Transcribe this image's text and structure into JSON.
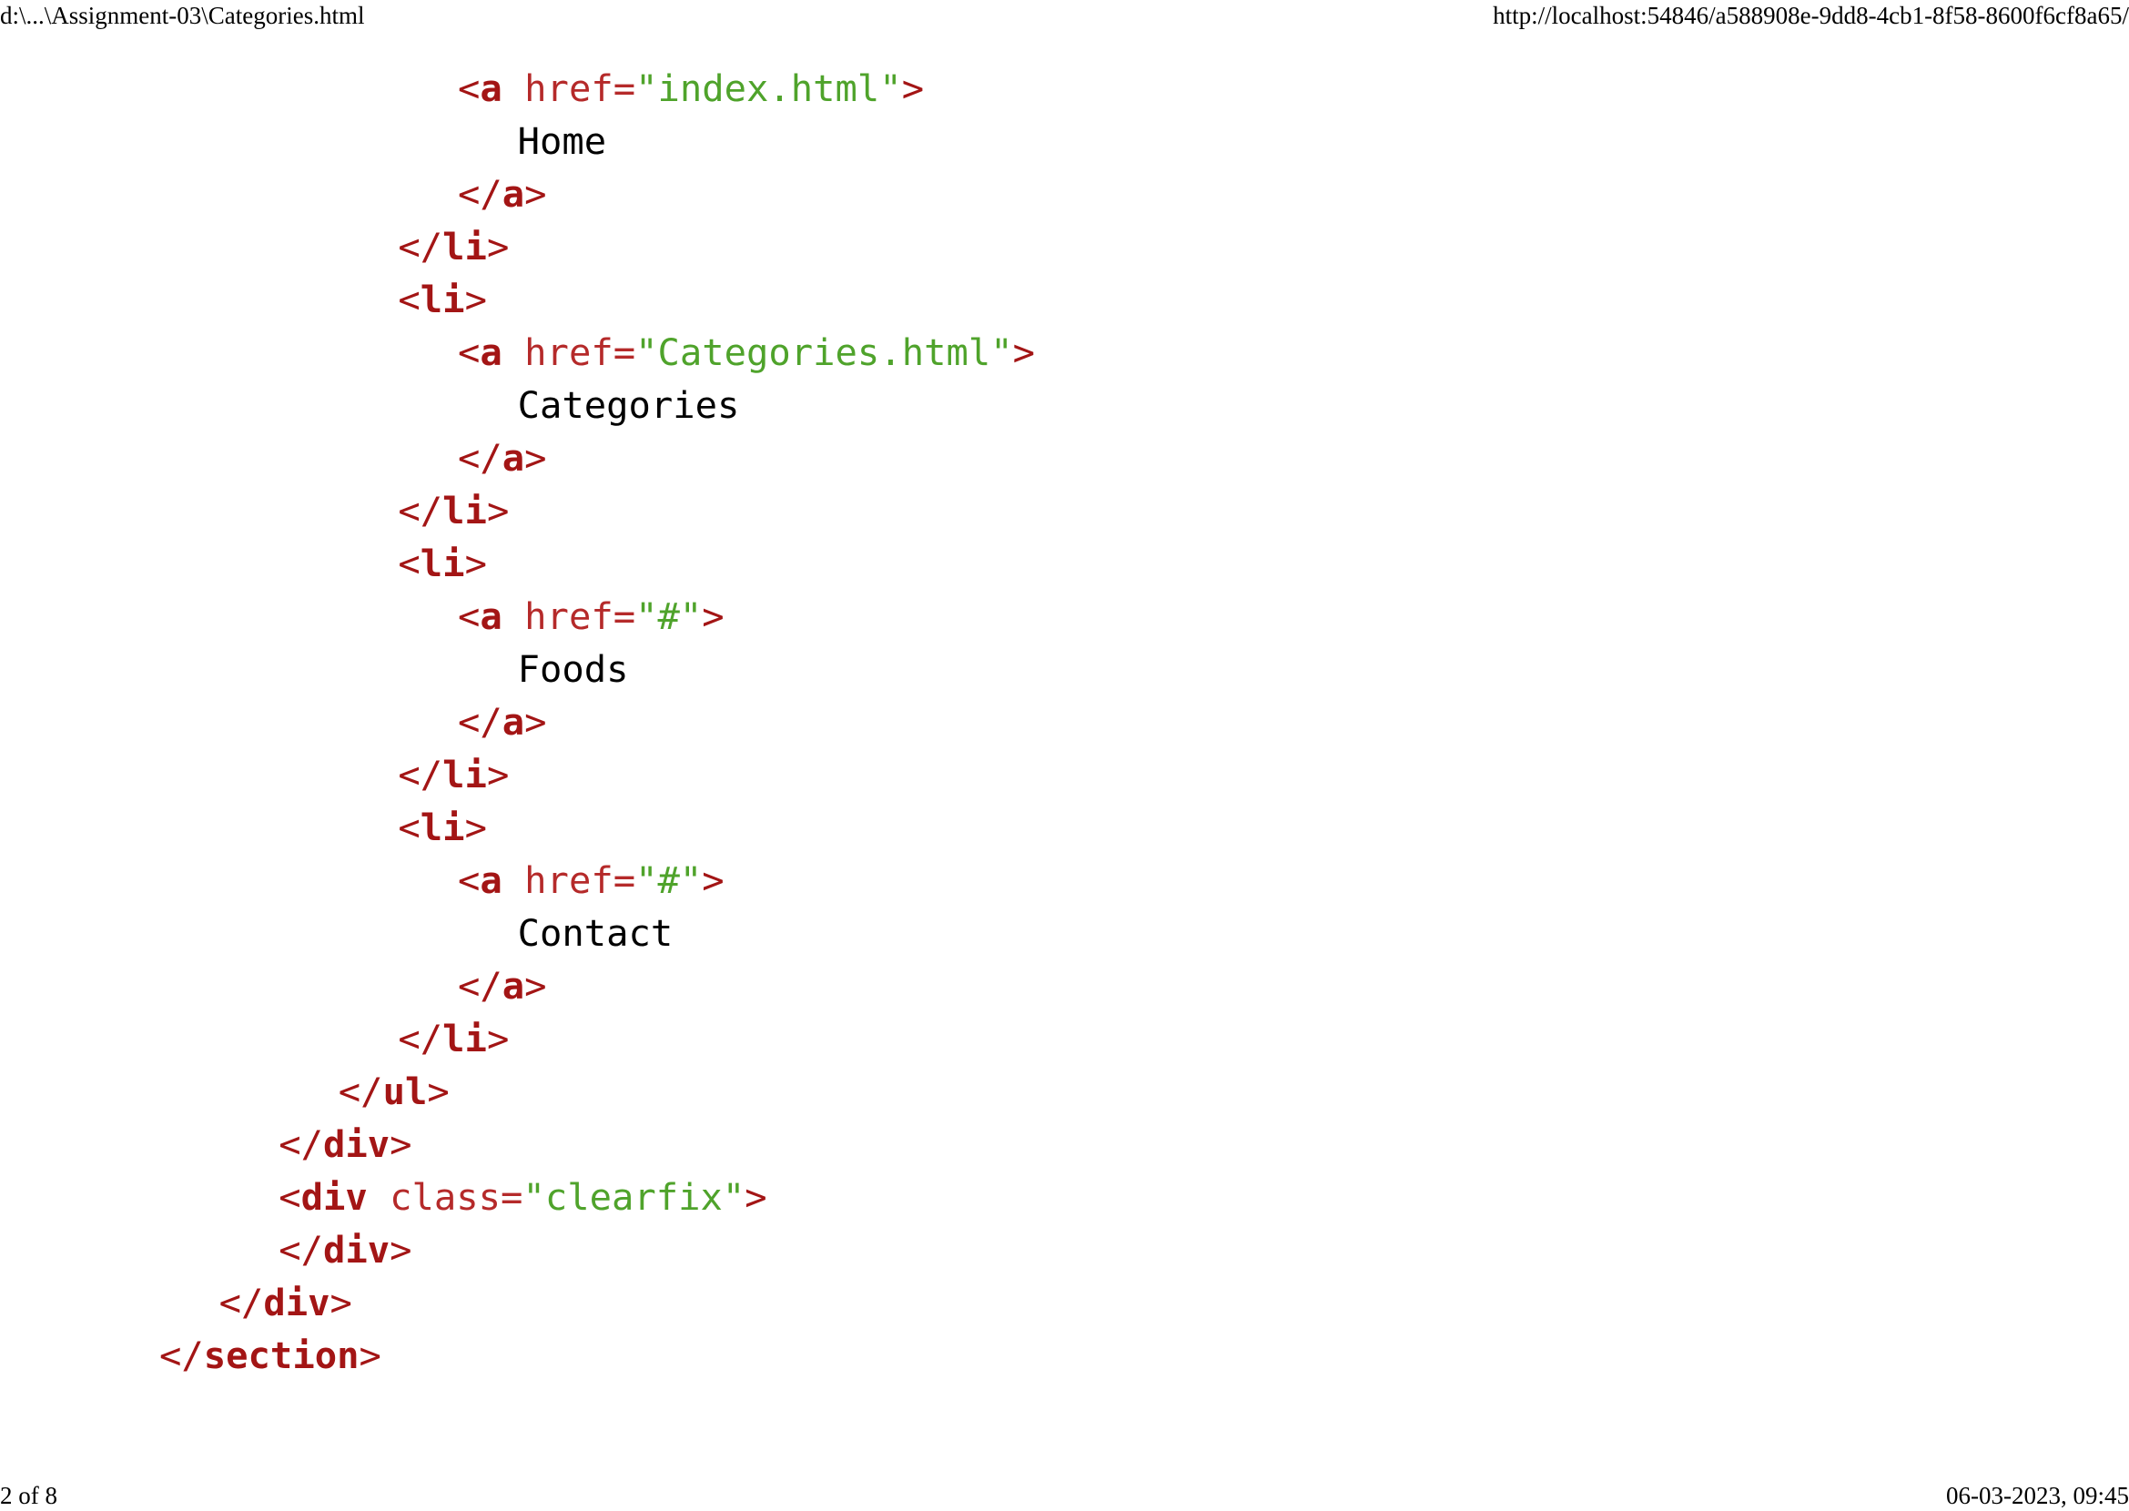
{
  "header": {
    "file_path": "d:\\...\\Assignment-03\\Categories.html",
    "url": "http://localhost:54846/a588908e-9dd8-4cb1-8f58-8600f6cf8a65/"
  },
  "footer": {
    "page_indicator": "2 of 8",
    "datetime": "06-03-2023, 09:45"
  },
  "colors": {
    "tag": "#a31515",
    "attribute_value": "#4fa32b",
    "text": "#000000"
  },
  "code": {
    "lines": [
      {
        "indent": 5,
        "tokens": [
          {
            "t": "punc",
            "v": "<"
          },
          {
            "t": "tag",
            "v": "a"
          },
          {
            "t": "punc",
            "v": " "
          },
          {
            "t": "attr",
            "v": "href="
          },
          {
            "t": "val",
            "v": "\"index.html\""
          },
          {
            "t": "punc",
            "v": ">"
          }
        ]
      },
      {
        "indent": 6,
        "tokens": [
          {
            "t": "text",
            "v": "Home"
          }
        ]
      },
      {
        "indent": 5,
        "tokens": [
          {
            "t": "punc",
            "v": "</"
          },
          {
            "t": "tag",
            "v": "a"
          },
          {
            "t": "punc",
            "v": ">"
          }
        ]
      },
      {
        "indent": 4,
        "tokens": [
          {
            "t": "punc",
            "v": "</"
          },
          {
            "t": "tag",
            "v": "li"
          },
          {
            "t": "punc",
            "v": ">"
          }
        ]
      },
      {
        "indent": 4,
        "tokens": [
          {
            "t": "punc",
            "v": "<"
          },
          {
            "t": "tag",
            "v": "li"
          },
          {
            "t": "punc",
            "v": ">"
          }
        ]
      },
      {
        "indent": 5,
        "tokens": [
          {
            "t": "punc",
            "v": "<"
          },
          {
            "t": "tag",
            "v": "a"
          },
          {
            "t": "punc",
            "v": " "
          },
          {
            "t": "attr",
            "v": "href="
          },
          {
            "t": "val",
            "v": "\"Categories.html\""
          },
          {
            "t": "punc",
            "v": ">"
          }
        ]
      },
      {
        "indent": 6,
        "tokens": [
          {
            "t": "text",
            "v": "Categories"
          }
        ]
      },
      {
        "indent": 5,
        "tokens": [
          {
            "t": "punc",
            "v": "</"
          },
          {
            "t": "tag",
            "v": "a"
          },
          {
            "t": "punc",
            "v": ">"
          }
        ]
      },
      {
        "indent": 4,
        "tokens": [
          {
            "t": "punc",
            "v": "</"
          },
          {
            "t": "tag",
            "v": "li"
          },
          {
            "t": "punc",
            "v": ">"
          }
        ]
      },
      {
        "indent": 4,
        "tokens": [
          {
            "t": "punc",
            "v": "<"
          },
          {
            "t": "tag",
            "v": "li"
          },
          {
            "t": "punc",
            "v": ">"
          }
        ]
      },
      {
        "indent": 5,
        "tokens": [
          {
            "t": "punc",
            "v": "<"
          },
          {
            "t": "tag",
            "v": "a"
          },
          {
            "t": "punc",
            "v": " "
          },
          {
            "t": "attr",
            "v": "href="
          },
          {
            "t": "val",
            "v": "\"#\""
          },
          {
            "t": "punc",
            "v": ">"
          }
        ]
      },
      {
        "indent": 6,
        "tokens": [
          {
            "t": "text",
            "v": "Foods"
          }
        ]
      },
      {
        "indent": 5,
        "tokens": [
          {
            "t": "punc",
            "v": "</"
          },
          {
            "t": "tag",
            "v": "a"
          },
          {
            "t": "punc",
            "v": ">"
          }
        ]
      },
      {
        "indent": 4,
        "tokens": [
          {
            "t": "punc",
            "v": "</"
          },
          {
            "t": "tag",
            "v": "li"
          },
          {
            "t": "punc",
            "v": ">"
          }
        ]
      },
      {
        "indent": 4,
        "tokens": [
          {
            "t": "punc",
            "v": "<"
          },
          {
            "t": "tag",
            "v": "li"
          },
          {
            "t": "punc",
            "v": ">"
          }
        ]
      },
      {
        "indent": 5,
        "tokens": [
          {
            "t": "punc",
            "v": "<"
          },
          {
            "t": "tag",
            "v": "a"
          },
          {
            "t": "punc",
            "v": " "
          },
          {
            "t": "attr",
            "v": "href="
          },
          {
            "t": "val",
            "v": "\"#\""
          },
          {
            "t": "punc",
            "v": ">"
          }
        ]
      },
      {
        "indent": 6,
        "tokens": [
          {
            "t": "text",
            "v": "Contact"
          }
        ]
      },
      {
        "indent": 5,
        "tokens": [
          {
            "t": "punc",
            "v": "</"
          },
          {
            "t": "tag",
            "v": "a"
          },
          {
            "t": "punc",
            "v": ">"
          }
        ]
      },
      {
        "indent": 4,
        "tokens": [
          {
            "t": "punc",
            "v": "</"
          },
          {
            "t": "tag",
            "v": "li"
          },
          {
            "t": "punc",
            "v": ">"
          }
        ]
      },
      {
        "indent": 3,
        "tokens": [
          {
            "t": "punc",
            "v": "</"
          },
          {
            "t": "tag",
            "v": "ul"
          },
          {
            "t": "punc",
            "v": ">"
          }
        ]
      },
      {
        "indent": 2,
        "tokens": [
          {
            "t": "punc",
            "v": "</"
          },
          {
            "t": "tag",
            "v": "div"
          },
          {
            "t": "punc",
            "v": ">"
          }
        ]
      },
      {
        "indent": 2,
        "tokens": [
          {
            "t": "punc",
            "v": "<"
          },
          {
            "t": "tag",
            "v": "div"
          },
          {
            "t": "punc",
            "v": " "
          },
          {
            "t": "attr",
            "v": "class="
          },
          {
            "t": "val",
            "v": "\"clearfix\""
          },
          {
            "t": "punc",
            "v": ">"
          }
        ]
      },
      {
        "indent": 2,
        "tokens": [
          {
            "t": "punc",
            "v": "</"
          },
          {
            "t": "tag",
            "v": "div"
          },
          {
            "t": "punc",
            "v": ">"
          }
        ]
      },
      {
        "indent": 1,
        "tokens": [
          {
            "t": "punc",
            "v": "</"
          },
          {
            "t": "tag",
            "v": "div"
          },
          {
            "t": "punc",
            "v": ">"
          }
        ]
      },
      {
        "indent": 0,
        "tokens": [
          {
            "t": "punc",
            "v": "</"
          },
          {
            "t": "tag",
            "v": "section"
          },
          {
            "t": "punc",
            "v": ">"
          }
        ]
      }
    ]
  }
}
